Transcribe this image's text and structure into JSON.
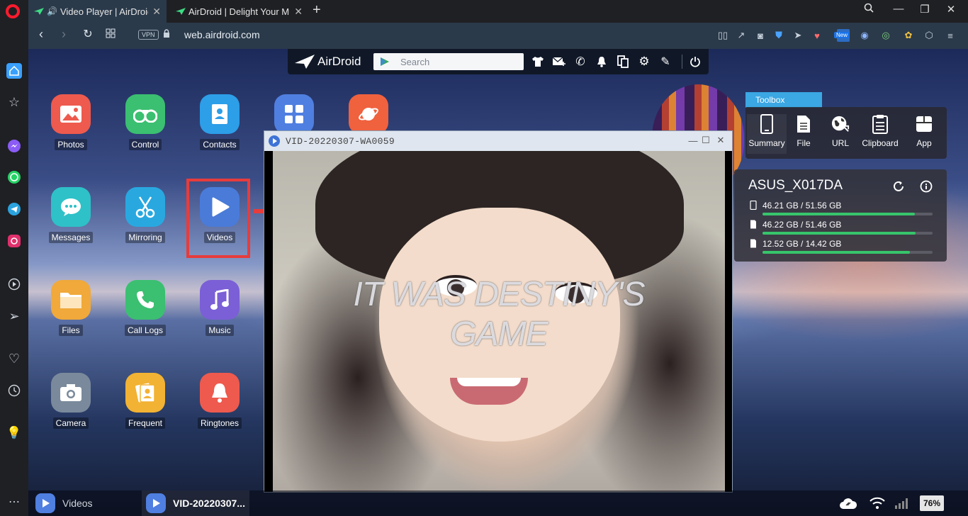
{
  "browser": {
    "tabs": [
      {
        "title": "Video Player | AirDroid",
        "active": true
      },
      {
        "title": "AirDroid | Delight Your Mul",
        "active": false
      }
    ],
    "url": "web.airdroid.com",
    "vpn_label": "VPN",
    "extension_badge": "New"
  },
  "airdroid": {
    "brand": "AirDroid",
    "search_placeholder": "Search",
    "apps": [
      {
        "label": "Photos"
      },
      {
        "label": "Control"
      },
      {
        "label": "Contacts"
      },
      {
        "label": "Messages"
      },
      {
        "label": "Mirroring"
      },
      {
        "label": "Videos"
      },
      {
        "label": "Files"
      },
      {
        "label": "Call Logs"
      },
      {
        "label": "Music"
      },
      {
        "label": "Camera"
      },
      {
        "label": "Frequent"
      },
      {
        "label": "Ringtones"
      }
    ],
    "highlighted_app": "Videos",
    "video_window": {
      "title": "VID-20220307-WA0059",
      "caption_line1": "IT WAS DESTINY'S",
      "caption_line2": "GAME"
    },
    "toolbox": {
      "tab_label": "Toolbox",
      "items": [
        {
          "label": "Summary"
        },
        {
          "label": "File"
        },
        {
          "label": "URL"
        },
        {
          "label": "Clipboard"
        },
        {
          "label": "App"
        }
      ]
    },
    "device": {
      "name": "ASUS_X017DA",
      "storage": [
        {
          "text": "46.21 GB / 51.56 GB",
          "fraction": 0.896
        },
        {
          "text": "46.22 GB / 51.46 GB",
          "fraction": 0.898
        },
        {
          "text": "12.52 GB / 14.42 GB",
          "fraction": 0.868
        }
      ]
    },
    "taskbar": {
      "items": [
        {
          "label": "Videos",
          "active": false
        },
        {
          "label": "VID-20220307...",
          "active": true
        }
      ],
      "battery": "76%"
    }
  },
  "colors": {
    "accent": "#3ba7e3",
    "highlight_box": "#e73c3c",
    "storage_fill": "#37c56b"
  }
}
